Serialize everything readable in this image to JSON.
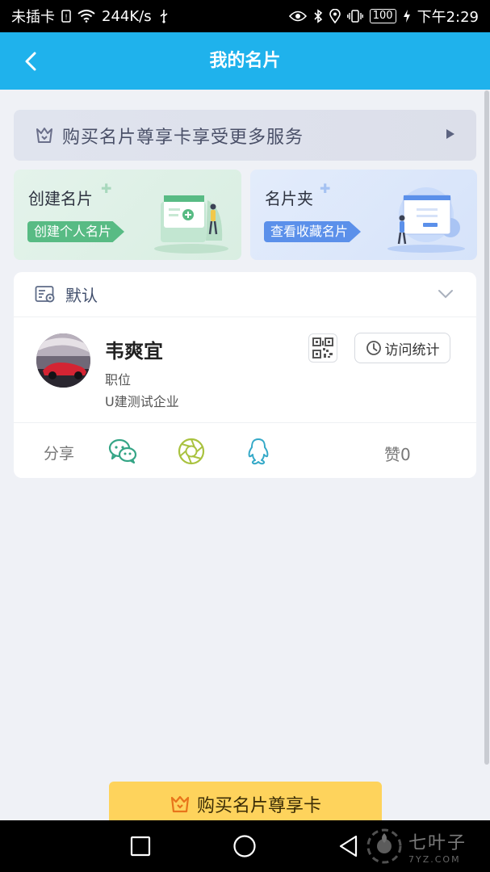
{
  "status_bar": {
    "carrier": "未插卡",
    "speed": "244K/s",
    "battery": "100",
    "time": "下午2:29"
  },
  "header": {
    "title": "我的名片"
  },
  "vip_banner": {
    "text": "购买名片尊享卡享受更多服务"
  },
  "cards": {
    "create": {
      "title": "创建名片",
      "tag": "创建个人名片"
    },
    "folder": {
      "title": "名片夹",
      "tag": "查看收藏名片"
    }
  },
  "bizcard": {
    "section_label": "默认",
    "name": "韦爽宜",
    "position": "职位",
    "company": "U建测试企业",
    "stats_label": "访问统计",
    "share_label": "分享",
    "likes": "赞0"
  },
  "bottom_button": {
    "label": "购买名片尊享卡"
  },
  "watermark": {
    "main": "七叶子",
    "sub": "7YZ.COM"
  },
  "colors": {
    "header_bg": "#1fb2ec",
    "buy_button": "#fed35c",
    "tag_green": "#58bb84",
    "tag_blue": "#5b90ea",
    "wechat": "#35a586",
    "moments": "#a9c23f",
    "qq": "#35a9c8"
  },
  "icons": [
    "wifi-icon",
    "usb-icon",
    "eye-icon",
    "bluetooth-icon",
    "location-icon",
    "vibrate-icon",
    "charge-icon",
    "back-icon",
    "crown-icon",
    "play-arrow-icon",
    "card-icon",
    "chevron-down-icon",
    "qr-code-icon",
    "clock-icon",
    "wechat-icon",
    "moments-icon",
    "qq-icon",
    "square-icon",
    "circle-icon",
    "triangle-back-icon"
  ]
}
